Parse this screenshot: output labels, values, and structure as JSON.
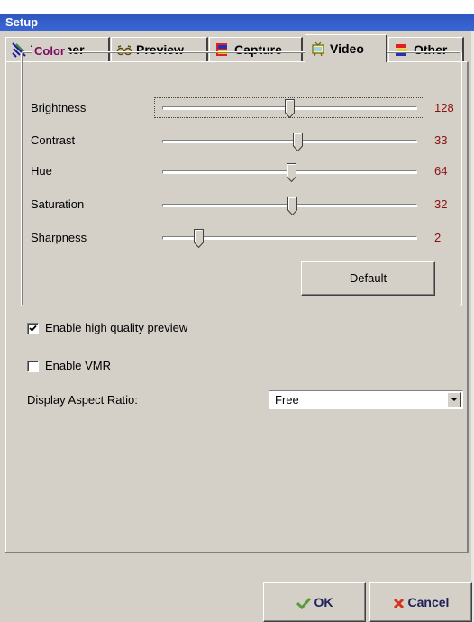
{
  "window": {
    "title": "Setup"
  },
  "tabs": [
    {
      "label": "TV Tuner",
      "icon": "tv-tuner-icon"
    },
    {
      "label": "Preview",
      "icon": "glasses-icon"
    },
    {
      "label": "Capture",
      "icon": "capture-icon"
    },
    {
      "label": "Video",
      "icon": "tv-icon",
      "active": true
    },
    {
      "label": "Other",
      "icon": "other-icon"
    }
  ],
  "color_group": {
    "label": "Color",
    "sliders": [
      {
        "label": "Brightness",
        "value": "128",
        "position_fraction": 0.5
      },
      {
        "label": "Contrast",
        "value": "33",
        "position_fraction": 0.52
      },
      {
        "label": "Hue",
        "value": "64",
        "position_fraction": 0.5
      },
      {
        "label": "Saturation",
        "value": "32",
        "position_fraction": 0.5
      },
      {
        "label": "Sharpness",
        "value": "2",
        "position_fraction": 0.14
      }
    ],
    "default_button": "Default"
  },
  "options": {
    "high_quality_preview": {
      "label": "Enable high quality preview",
      "checked": true
    },
    "enable_vmr": {
      "label": "Enable VMR",
      "checked": false
    }
  },
  "aspect_ratio": {
    "label": "Display Aspect Ratio:",
    "selected": "Free"
  },
  "footer": {
    "ok_label": "OK",
    "cancel_label": "Cancel"
  },
  "colors": {
    "title_bar": "#3a66d4",
    "group_label": "#7a0a62",
    "value_text": "#8b1010",
    "face": "#d4d0c8"
  }
}
